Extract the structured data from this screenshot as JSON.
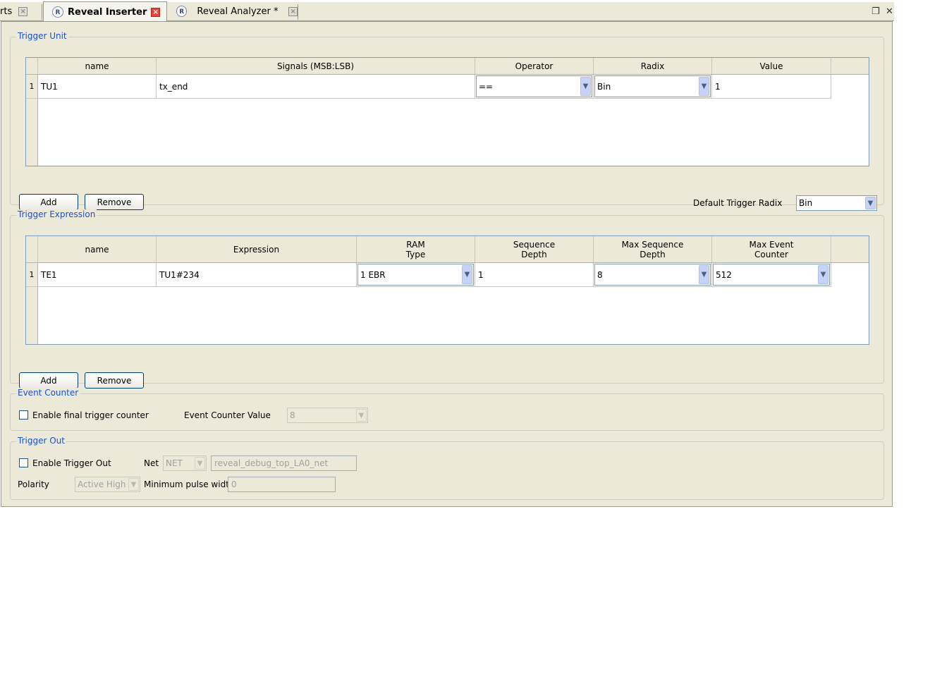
{
  "tabs": [
    {
      "label": "rts",
      "active": false
    },
    {
      "label": "Reveal Inserter",
      "active": true
    },
    {
      "label": "Reveal Analyzer *",
      "active": false
    }
  ],
  "trigger_unit": {
    "legend": "Trigger Unit",
    "columns": [
      "name",
      "Signals (MSB:LSB)",
      "Operator",
      "Radix",
      "Value"
    ],
    "rows": [
      {
        "num": "1",
        "name": "TU1",
        "signals": "tx_end",
        "operator": "==",
        "radix": "Bin",
        "value": "1"
      }
    ],
    "add_label": "Add",
    "remove_label": "Remove",
    "default_radix_label": "Default Trigger Radix",
    "default_radix_value": "Bin"
  },
  "trigger_expression": {
    "legend": "Trigger Expression",
    "columns": [
      "name",
      "Expression",
      "RAM\nType",
      "Sequence\nDepth",
      "Max Sequence\nDepth",
      "Max Event\nCounter"
    ],
    "rows": [
      {
        "num": "1",
        "name": "TE1",
        "expression": "TU1#234",
        "ram_type": "1 EBR",
        "seq_depth": "1",
        "max_seq_depth": "8",
        "max_event_counter": "512"
      }
    ],
    "add_label": "Add",
    "remove_label": "Remove"
  },
  "event_counter": {
    "legend": "Event Counter",
    "enable_label": "Enable final trigger counter",
    "value_label": "Event Counter Value",
    "value": "8"
  },
  "trigger_out": {
    "legend": "Trigger Out",
    "enable_label": "Enable Trigger Out",
    "net_label": "Net",
    "net_type": "NET",
    "net_name": "reveal_debug_top_LA0_net",
    "polarity_label": "Polarity",
    "polarity_value": "Active High",
    "min_pulse_label": "Minimum pulse width",
    "min_pulse_value": "0"
  }
}
